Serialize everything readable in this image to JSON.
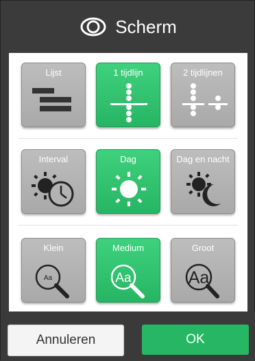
{
  "header": {
    "title": "Scherm",
    "icon": "eye-icon"
  },
  "rows": [
    {
      "name": "layout",
      "options": [
        {
          "label": "Lijst",
          "icon": "list-icon",
          "selected": false
        },
        {
          "label": "1 tijdlijn",
          "icon": "single-timeline-icon",
          "selected": true
        },
        {
          "label": "2 tijdlijnen",
          "icon": "double-timeline-icon",
          "selected": false
        }
      ]
    },
    {
      "name": "time-period",
      "options": [
        {
          "label": "Interval",
          "icon": "sun-cloud-clock-icon",
          "selected": false
        },
        {
          "label": "Dag",
          "icon": "sun-icon",
          "selected": true
        },
        {
          "label": "Dag en nacht",
          "icon": "sun-moon-icon",
          "selected": false
        }
      ]
    },
    {
      "name": "text-size",
      "options": [
        {
          "label": "Klein",
          "icon": "magnifier-small-icon",
          "selected": false
        },
        {
          "label": "Medium",
          "icon": "magnifier-medium-icon",
          "selected": true
        },
        {
          "label": "Groot",
          "icon": "magnifier-large-icon",
          "selected": false
        }
      ]
    }
  ],
  "magnifier_text": "Aa",
  "footer": {
    "cancel_label": "Annuleren",
    "ok_label": "OK"
  },
  "colors": {
    "selected": "#27b764",
    "unselected": "#b0b0b0",
    "background": "#3a3a3a"
  }
}
